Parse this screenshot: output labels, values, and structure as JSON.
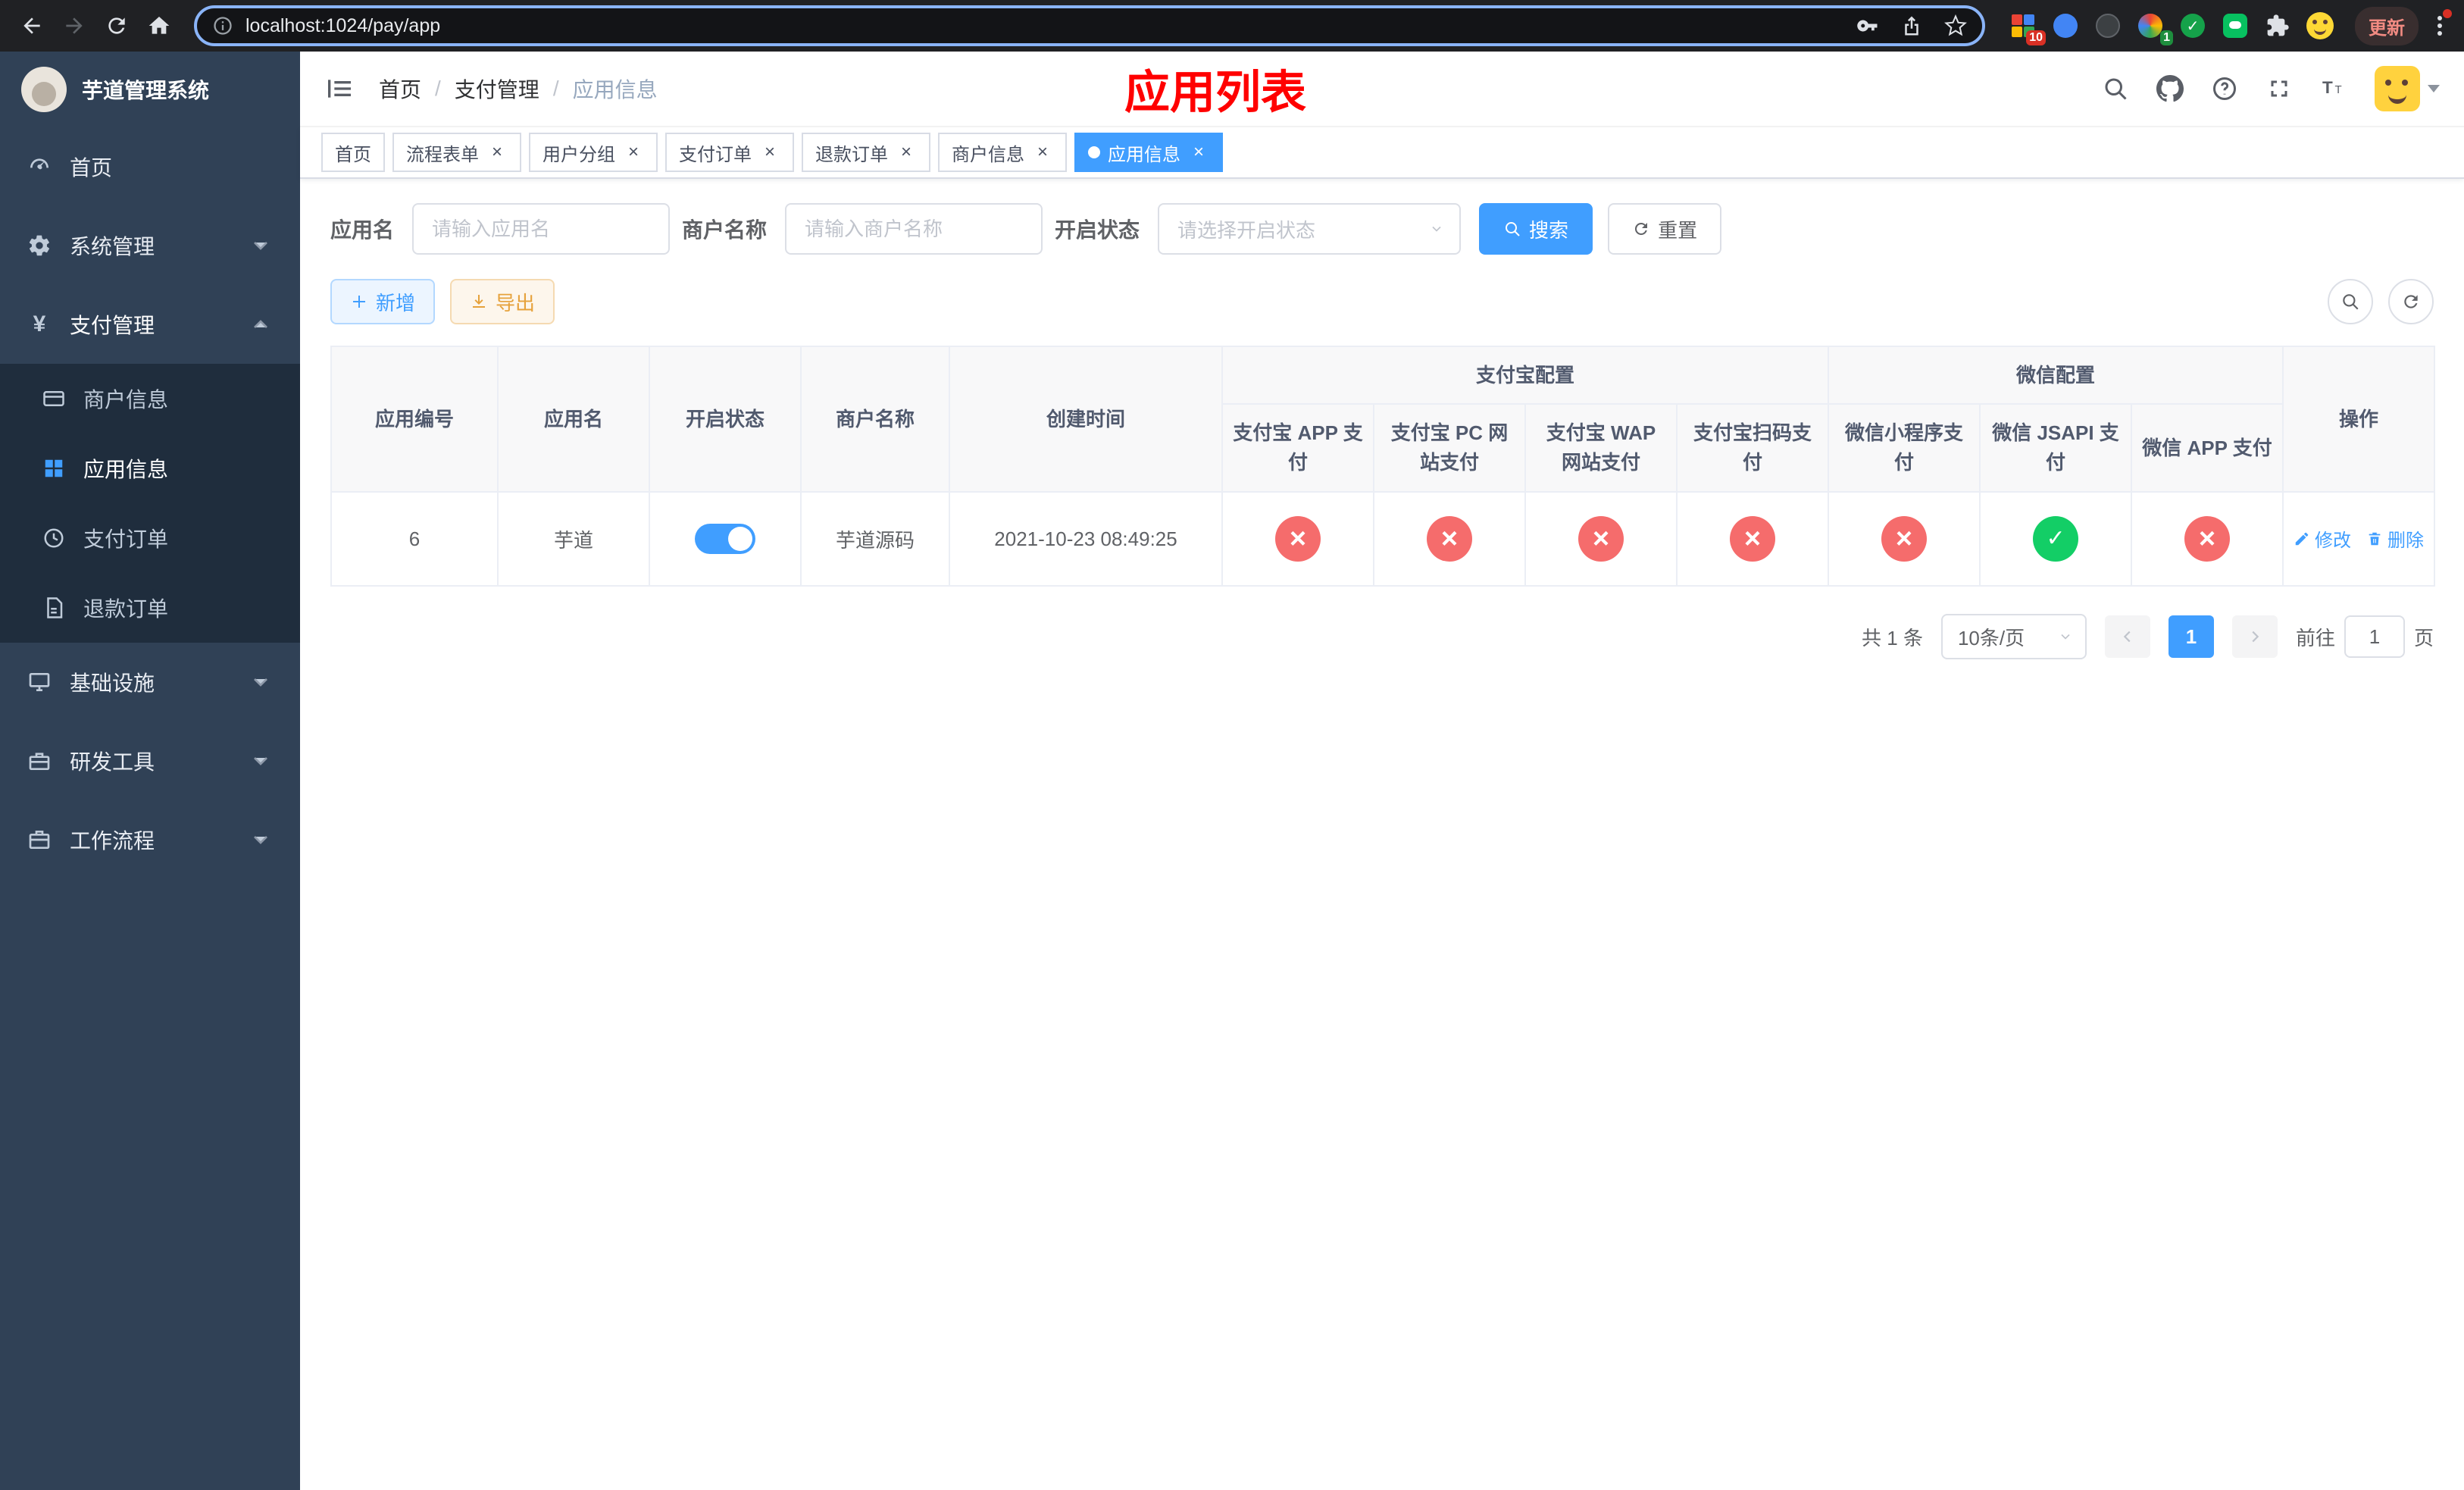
{
  "browser": {
    "url": "localhost:1024/pay/app",
    "update_label": "更新",
    "ext_badge_grid": "10",
    "ext_badge_avatar": "1"
  },
  "sidebar": {
    "title": "芋道管理系统",
    "items": {
      "home": "首页",
      "system": "系统管理",
      "pay": "支付管理",
      "merchant": "商户信息",
      "app": "应用信息",
      "order": "支付订单",
      "refund": "退款订单",
      "infra": "基础设施",
      "devtools": "研发工具",
      "workflow": "工作流程"
    }
  },
  "header": {
    "breadcrumb": [
      "首页",
      "支付管理",
      "应用信息"
    ],
    "list_title": "应用列表"
  },
  "tabs": [
    {
      "label": "首页"
    },
    {
      "label": "流程表单"
    },
    {
      "label": "用户分组"
    },
    {
      "label": "支付订单"
    },
    {
      "label": "退款订单"
    },
    {
      "label": "商户信息"
    },
    {
      "label": "应用信息"
    }
  ],
  "filters": {
    "app_name_label": "应用名",
    "app_name_placeholder": "请输入应用名",
    "merchant_label": "商户名称",
    "merchant_placeholder": "请输入商户名称",
    "status_label": "开启状态",
    "status_placeholder": "请选择开启状态",
    "search_label": "搜索",
    "reset_label": "重置"
  },
  "toolbar": {
    "add_label": "新增",
    "export_label": "导出"
  },
  "table": {
    "groups": {
      "alipay": "支付宝配置",
      "wechat": "微信配置"
    },
    "columns": {
      "id": "应用编号",
      "name": "应用名",
      "status": "开启状态",
      "merchant": "商户名称",
      "created": "创建时间",
      "alipay_app": "支付宝 APP 支付",
      "alipay_pc": "支付宝 PC 网站支付",
      "alipay_wap": "支付宝 WAP 网站支付",
      "alipay_qr": "支付宝扫码支付",
      "wx_mini": "微信小程序支付",
      "wx_jsapi": "微信 JSAPI 支付",
      "wx_app": "微信 APP 支付",
      "actions": "操作"
    },
    "rows": [
      {
        "id": "6",
        "name": "芋道",
        "enabled": true,
        "merchant": "芋道源码",
        "created": "2021-10-23 08:49:25",
        "alipay_app": false,
        "alipay_pc": false,
        "alipay_wap": false,
        "alipay_qr": false,
        "wx_mini": false,
        "wx_jsapi": true,
        "wx_app": false
      }
    ],
    "actions": {
      "edit": "修改",
      "delete": "删除"
    }
  },
  "pagination": {
    "total": "共 1 条",
    "page_size": "10条/页",
    "page": "1",
    "goto_prefix": "前往",
    "goto_value": "1",
    "goto_suffix": "页"
  },
  "colors": {
    "accent": "#409eff",
    "danger": "#f56c6c",
    "success": "#13ce66",
    "title_red": "#ff0000"
  }
}
